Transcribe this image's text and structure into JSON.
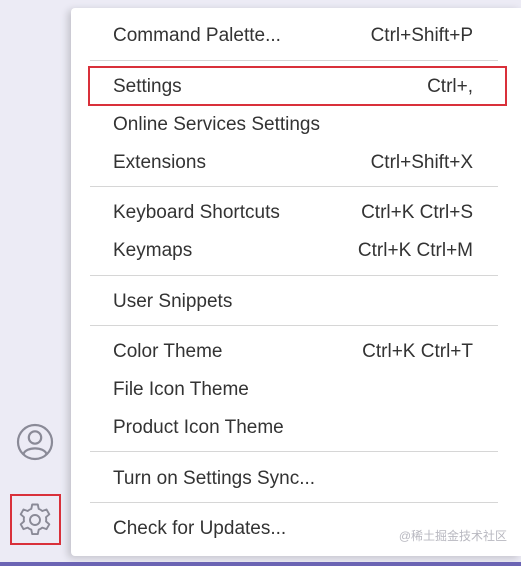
{
  "activity_bar": {
    "account_icon": "account-icon",
    "manage_icon": "gear-icon"
  },
  "menu": {
    "items": [
      {
        "label": "Command Palette...",
        "shortcut": "Ctrl+Shift+P"
      },
      {
        "label": "Settings",
        "shortcut": "Ctrl+,"
      },
      {
        "label": "Online Services Settings",
        "shortcut": ""
      },
      {
        "label": "Extensions",
        "shortcut": "Ctrl+Shift+X"
      },
      {
        "label": "Keyboard Shortcuts",
        "shortcut": "Ctrl+K Ctrl+S"
      },
      {
        "label": "Keymaps",
        "shortcut": "Ctrl+K Ctrl+M"
      },
      {
        "label": "User Snippets",
        "shortcut": ""
      },
      {
        "label": "Color Theme",
        "shortcut": "Ctrl+K Ctrl+T"
      },
      {
        "label": "File Icon Theme",
        "shortcut": ""
      },
      {
        "label": "Product Icon Theme",
        "shortcut": ""
      },
      {
        "label": "Turn on Settings Sync...",
        "shortcut": ""
      },
      {
        "label": "Check for Updates...",
        "shortcut": ""
      }
    ]
  },
  "watermark": "@稀土掘金技术社区",
  "colors": {
    "highlight_border": "#d9303a",
    "menu_text": "#333333",
    "activity_bar_bg": "#ecebf5",
    "bottom_strip": "#6b64b4"
  }
}
